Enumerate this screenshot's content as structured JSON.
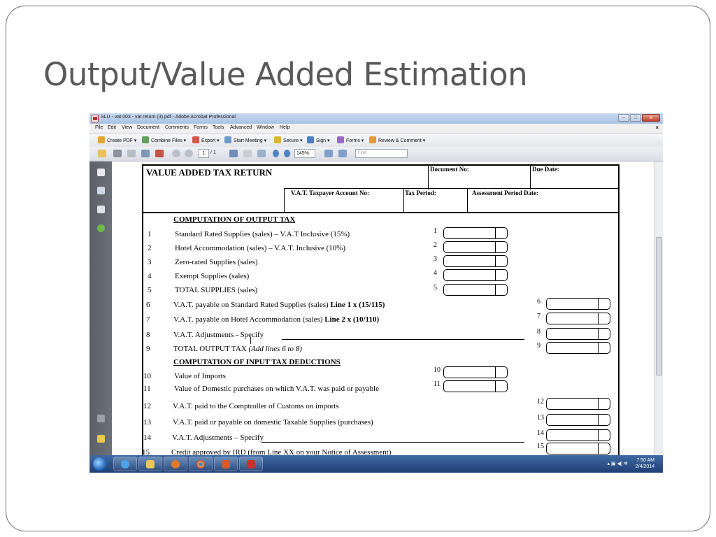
{
  "slide": {
    "title": "Output/Value Added Estimation"
  },
  "window": {
    "title": "SLU - vat 003 - vat return (3).pdf - Adobe Acrobat Professional",
    "menu": [
      "File",
      "Edit",
      "View",
      "Document",
      "Comments",
      "Forms",
      "Tools",
      "Advanced",
      "Window",
      "Help"
    ],
    "menu_close": "×",
    "controls": {
      "minimize": "–",
      "maximize": "□",
      "close": "x"
    }
  },
  "toolbar": {
    "items": [
      "Create PDF ▾",
      "Combine Files ▾",
      "Export ▾",
      "Start Meeting ▾",
      "Secure ▾",
      "Sign ▾",
      "Forms ▾",
      "Review & Comment ▾"
    ],
    "page_current": "1",
    "page_total": "/ 1",
    "zoom": "145%",
    "find_placeholder": "Find"
  },
  "taskbar": {
    "time": "7:50 AM",
    "date": "2/4/2014"
  },
  "form": {
    "title": "VALUE ADDED TAX RETURN",
    "document_no": "Document No:",
    "due_date": "Due Date:",
    "taxpayer_account": "V.A.T. Taxpayer Account No:",
    "tax_period": "Tax Period:",
    "assessment_period": "Assessment Period Date:",
    "section_output": "COMPUTATION OF OUTPUT TAX",
    "section_input": "COMPUTATION OF INPUT TAX DEDUCTIONS",
    "lines": [
      {
        "num": "1",
        "text": "Standard Rated Supplies (sales)  – V.A.T Inclusive (15%)",
        "bold": "",
        "ital": "",
        "box": "1"
      },
      {
        "num": "2",
        "text": "Hotel Accommodation (sales) – V.A.T. Inclusive (10%)",
        "bold": "",
        "ital": "",
        "box": "2"
      },
      {
        "num": "3",
        "text": "Zero-rated Supplies (sales)",
        "bold": "",
        "ital": "",
        "box": "3"
      },
      {
        "num": "4",
        "text": "Exempt Supplies (sales)",
        "bold": "",
        "ital": "",
        "box": "4"
      },
      {
        "num": "5",
        "text": "TOTAL SUPPLIES (sales)",
        "bold": "",
        "ital": "",
        "box": "5"
      },
      {
        "num": "6",
        "text": "V.A.T. payable on Standard Rated Supplies (sales) ",
        "bold": "Line 1 x (15/115)",
        "ital": "",
        "box": "6"
      },
      {
        "num": "7",
        "text": "V.A.T. payable on Hotel Accommodation (sales) ",
        "bold": "Line 2 x (10/110)",
        "ital": "",
        "box": "7"
      },
      {
        "num": "8",
        "text": "V.A.T. Adjustments - Specify",
        "bold": "",
        "ital": "",
        "box": "8"
      },
      {
        "num": "9",
        "text": "TOTAL OUTPUT TAX ",
        "bold": "",
        "ital": "(Add lines 6 to 8)",
        "box": "9"
      },
      {
        "num": "10",
        "text": "Value of Imports",
        "bold": "",
        "ital": "",
        "box": "10"
      },
      {
        "num": "11",
        "text": "Value of Domestic purchases on which V.A.T. was paid or payable",
        "bold": "",
        "ital": "",
        "box": "11"
      },
      {
        "num": "12",
        "text": "V.A.T. paid to the Comptroller of Customs on imports",
        "bold": "",
        "ital": "",
        "box": "12"
      },
      {
        "num": "13",
        "text": "V.A.T. paid or payable on domestic Taxable Supplies (purchases)",
        "bold": "",
        "ital": "",
        "box": "13"
      },
      {
        "num": "14",
        "text": "V.A.T. Adjustments – Specify",
        "bold": "",
        "ital": "",
        "box": "14"
      },
      {
        "num": "15",
        "text": "Credit approved by IRD (from Line XX on your Notice of Assessment)",
        "bold": "",
        "ital": "",
        "box": "15"
      }
    ]
  }
}
